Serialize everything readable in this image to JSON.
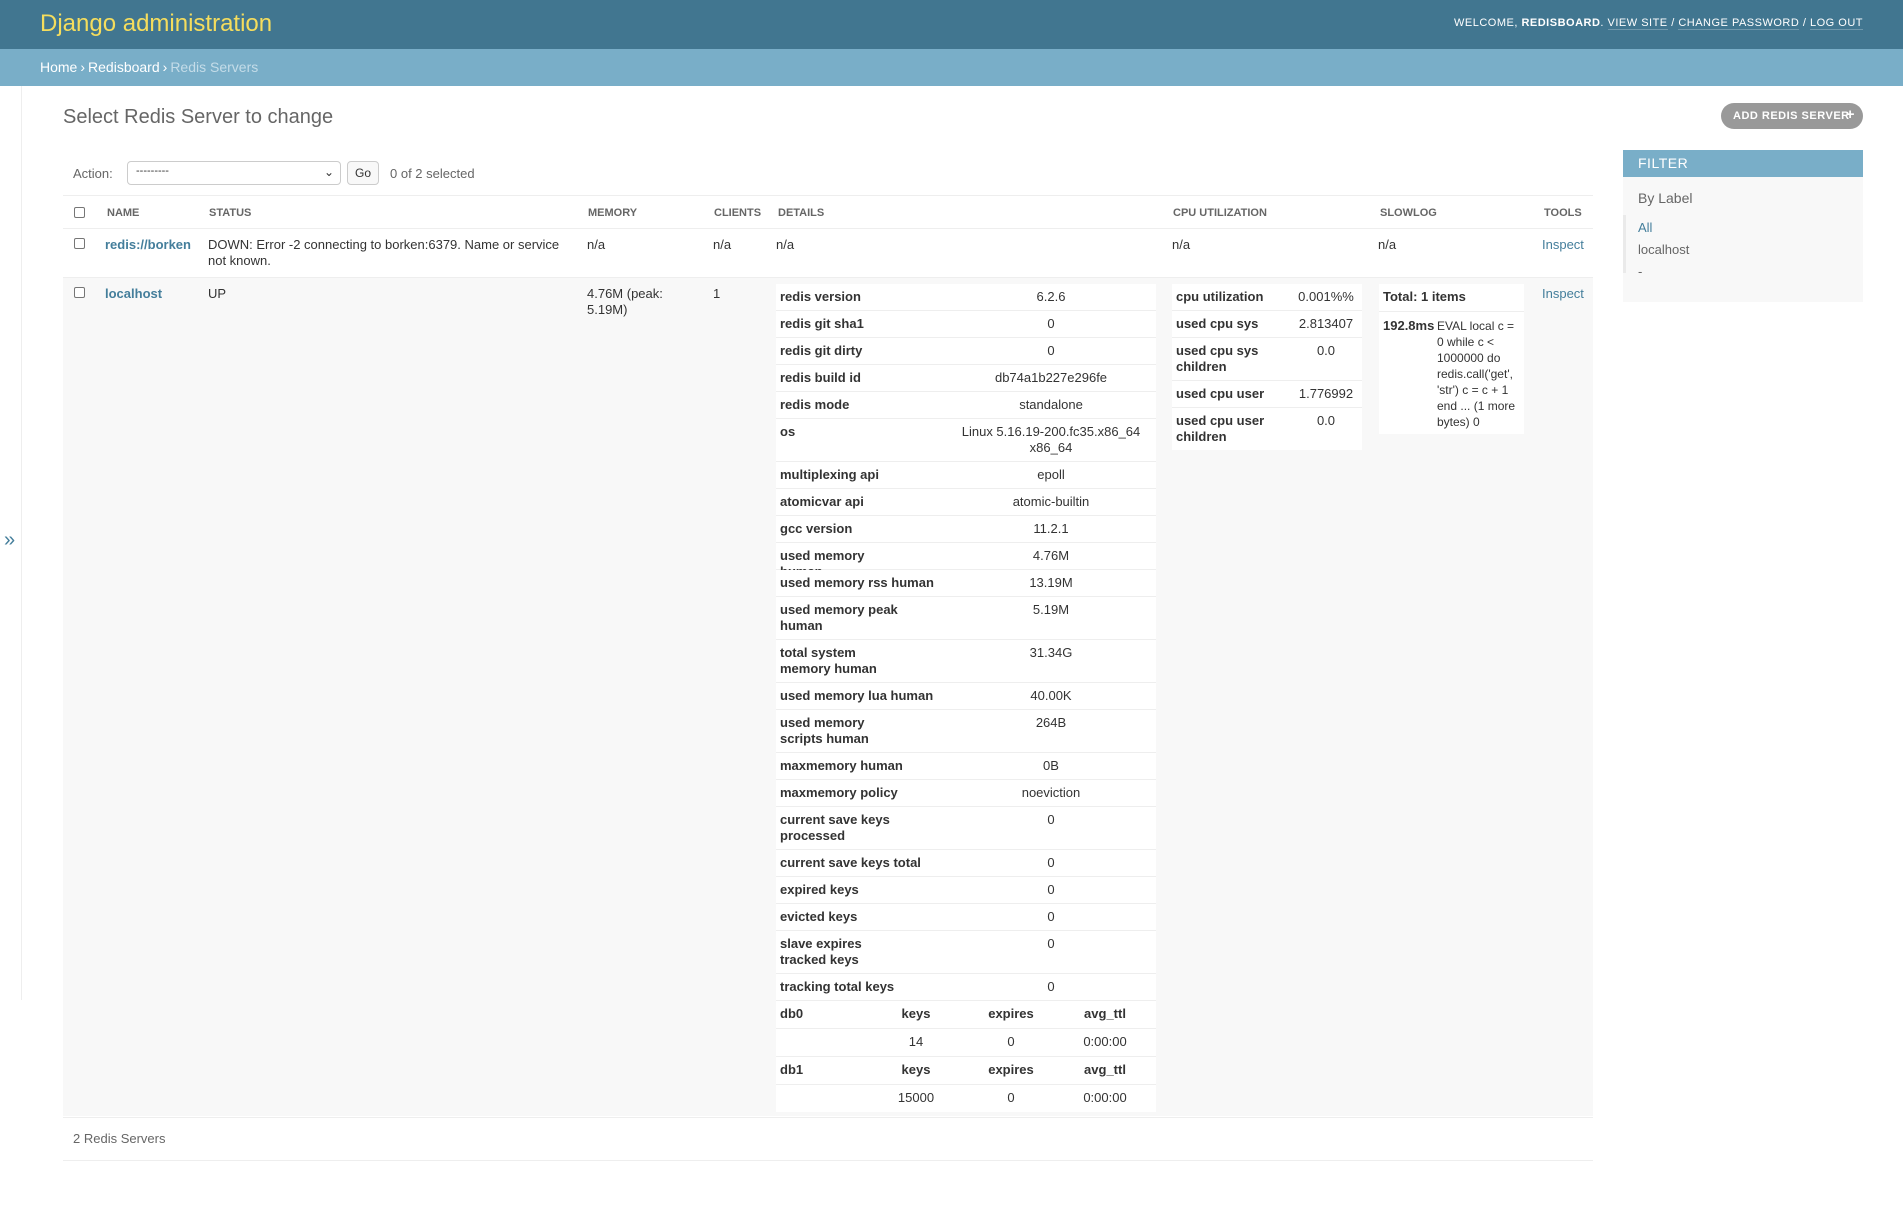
{
  "header": {
    "brand": "Django administration",
    "welcome": "Welcome,",
    "username": "redisboard",
    "view_site": "View site",
    "change_password": "Change password",
    "log_out": "Log out"
  },
  "breadcrumbs": {
    "home": "Home",
    "app": "Redisboard",
    "current": "Redis Servers"
  },
  "nav_toggle_icon": "»",
  "page": {
    "title": "Select Redis Server to change",
    "add_button": "Add Redis Server",
    "add_icon": "plus-icon"
  },
  "actions": {
    "label": "Action:",
    "select_value": "---------",
    "go": "Go",
    "selected": "0 of 2 selected"
  },
  "table": {
    "headers": [
      "Name",
      "Status",
      "Memory",
      "Clients",
      "Details",
      "CPU Utilization",
      "Slowlog",
      "Tools"
    ],
    "row1": {
      "name": "redis://borken",
      "status": "DOWN: Error -2 connecting to borken:6379. Name or service not known.",
      "memory": "n/a",
      "clients": "n/a",
      "details": "n/a",
      "cpu": "n/a",
      "slowlog": "n/a",
      "tools": "Inspect"
    },
    "row2": {
      "name": "localhost",
      "status": "UP",
      "memory": "4.76M (peak: 5.19M)",
      "clients": "1",
      "tools": "Inspect",
      "details": [
        {
          "key": "redis version",
          "value": "6.2.6"
        },
        {
          "key": "redis git sha1",
          "value": "0"
        },
        {
          "key": "redis git dirty",
          "value": "0"
        },
        {
          "key": "redis build id",
          "value": "db74a1b227e296fe"
        },
        {
          "key": "redis mode",
          "value": "standalone"
        },
        {
          "key": "os",
          "value": "Linux 5.16.19-200.fc35.x86_64 x86_64"
        },
        {
          "key": "multiplexing api",
          "value": "epoll"
        },
        {
          "key": "atomicvar api",
          "value": "atomic-builtin"
        },
        {
          "key": "gcc version",
          "value": "11.2.1"
        },
        {
          "key": "used memory human",
          "value": "4.76M"
        },
        {
          "key": "used memory rss human",
          "value": "13.19M"
        },
        {
          "key": "used memory peak human",
          "value": "5.19M"
        },
        {
          "key": "total system memory human",
          "value": "31.34G"
        },
        {
          "key": "used memory lua human",
          "value": "40.00K"
        },
        {
          "key": "used memory scripts human",
          "value": "264B"
        },
        {
          "key": "maxmemory human",
          "value": "0B"
        },
        {
          "key": "maxmemory policy",
          "value": "noeviction"
        },
        {
          "key": "current save keys processed",
          "value": "0"
        },
        {
          "key": "current save keys total",
          "value": "0"
        },
        {
          "key": "expired keys",
          "value": "0"
        },
        {
          "key": "evicted keys",
          "value": "0"
        },
        {
          "key": "slave expires tracked keys",
          "value": "0"
        },
        {
          "key": "tracking total keys",
          "value": "0"
        }
      ],
      "dbs": [
        {
          "name": "db0",
          "h_keys": "keys",
          "h_expires": "expires",
          "h_ttl": "avg_ttl",
          "keys": "14",
          "expires": "0",
          "avg_ttl": "0:00:00"
        },
        {
          "name": "db1",
          "h_keys": "keys",
          "h_expires": "expires",
          "h_ttl": "avg_ttl",
          "keys": "15000",
          "expires": "0",
          "avg_ttl": "0:00:00"
        }
      ],
      "cpu": [
        {
          "key": "cpu utilization",
          "value": "0.001%%"
        },
        {
          "key": "used cpu sys",
          "value": "2.813407"
        },
        {
          "key": "used cpu sys children",
          "value": "0.0"
        },
        {
          "key": "used cpu user",
          "value": "1.776992"
        },
        {
          "key": "used cpu user children",
          "value": "0.0"
        }
      ],
      "slowlog": {
        "total": "Total: 1 items",
        "duration": "192.8ms",
        "command": "EVAL local c = 0 while c < 1000000 do redis.call('get', 'str') c = c + 1 end ... (1 more bytes) 0"
      }
    }
  },
  "paginator": "2 Redis Servers",
  "filter": {
    "title": "Filter",
    "by": "By Label",
    "items": [
      "All",
      "localhost",
      "-"
    ]
  },
  "colors": {
    "header": "#417690",
    "brand": "#f5dd5d",
    "breadcrumbs": "#79aec8",
    "link": "#447e9b"
  }
}
